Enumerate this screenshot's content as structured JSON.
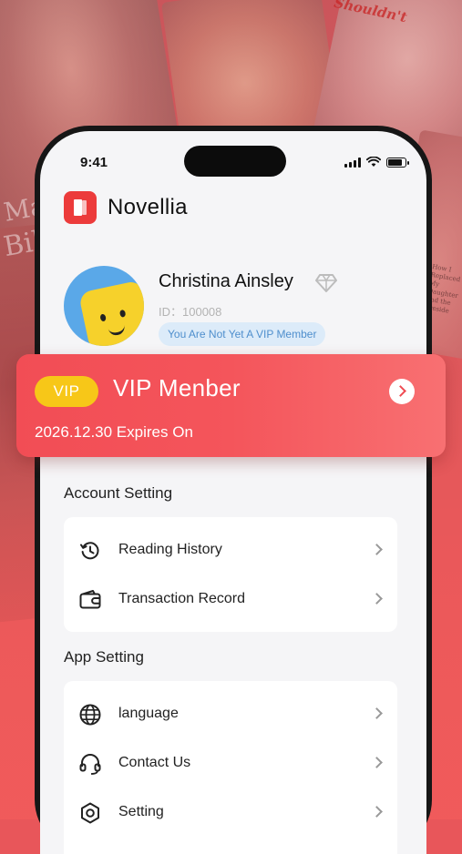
{
  "background": {
    "poster_text_1": "Mar",
    "poster_text_2": "Bill",
    "poster_text_3": "Shouldn't",
    "poster_text_4": "How I Replaced My Daughter and the Preside"
  },
  "status_bar": {
    "time": "9:41"
  },
  "app": {
    "name": "Novellia",
    "logo_icon": "book-icon"
  },
  "profile": {
    "name": "Christina Ainsley",
    "id_text": "ID：100008",
    "vip_status": "You Are Not Yet A VIP Member",
    "badge_icon": "diamond-icon"
  },
  "vip_card": {
    "badge": "VIP",
    "title": "VIP Menber",
    "expiry": "2026.12.30 Expires On",
    "colors": {
      "card": "#f24d55",
      "badge": "#f7c718"
    }
  },
  "account_setting": {
    "title": "Account Setting",
    "items": [
      {
        "label": "Reading History",
        "icon": "history-icon"
      },
      {
        "label": "Transaction  Record",
        "icon": "wallet-icon"
      }
    ]
  },
  "app_setting": {
    "title": "App Setting",
    "items": [
      {
        "label": "language",
        "icon": "globe-icon"
      },
      {
        "label": "Contact Us",
        "icon": "headset-icon"
      },
      {
        "label": "Setting",
        "icon": "gear-icon"
      }
    ]
  }
}
